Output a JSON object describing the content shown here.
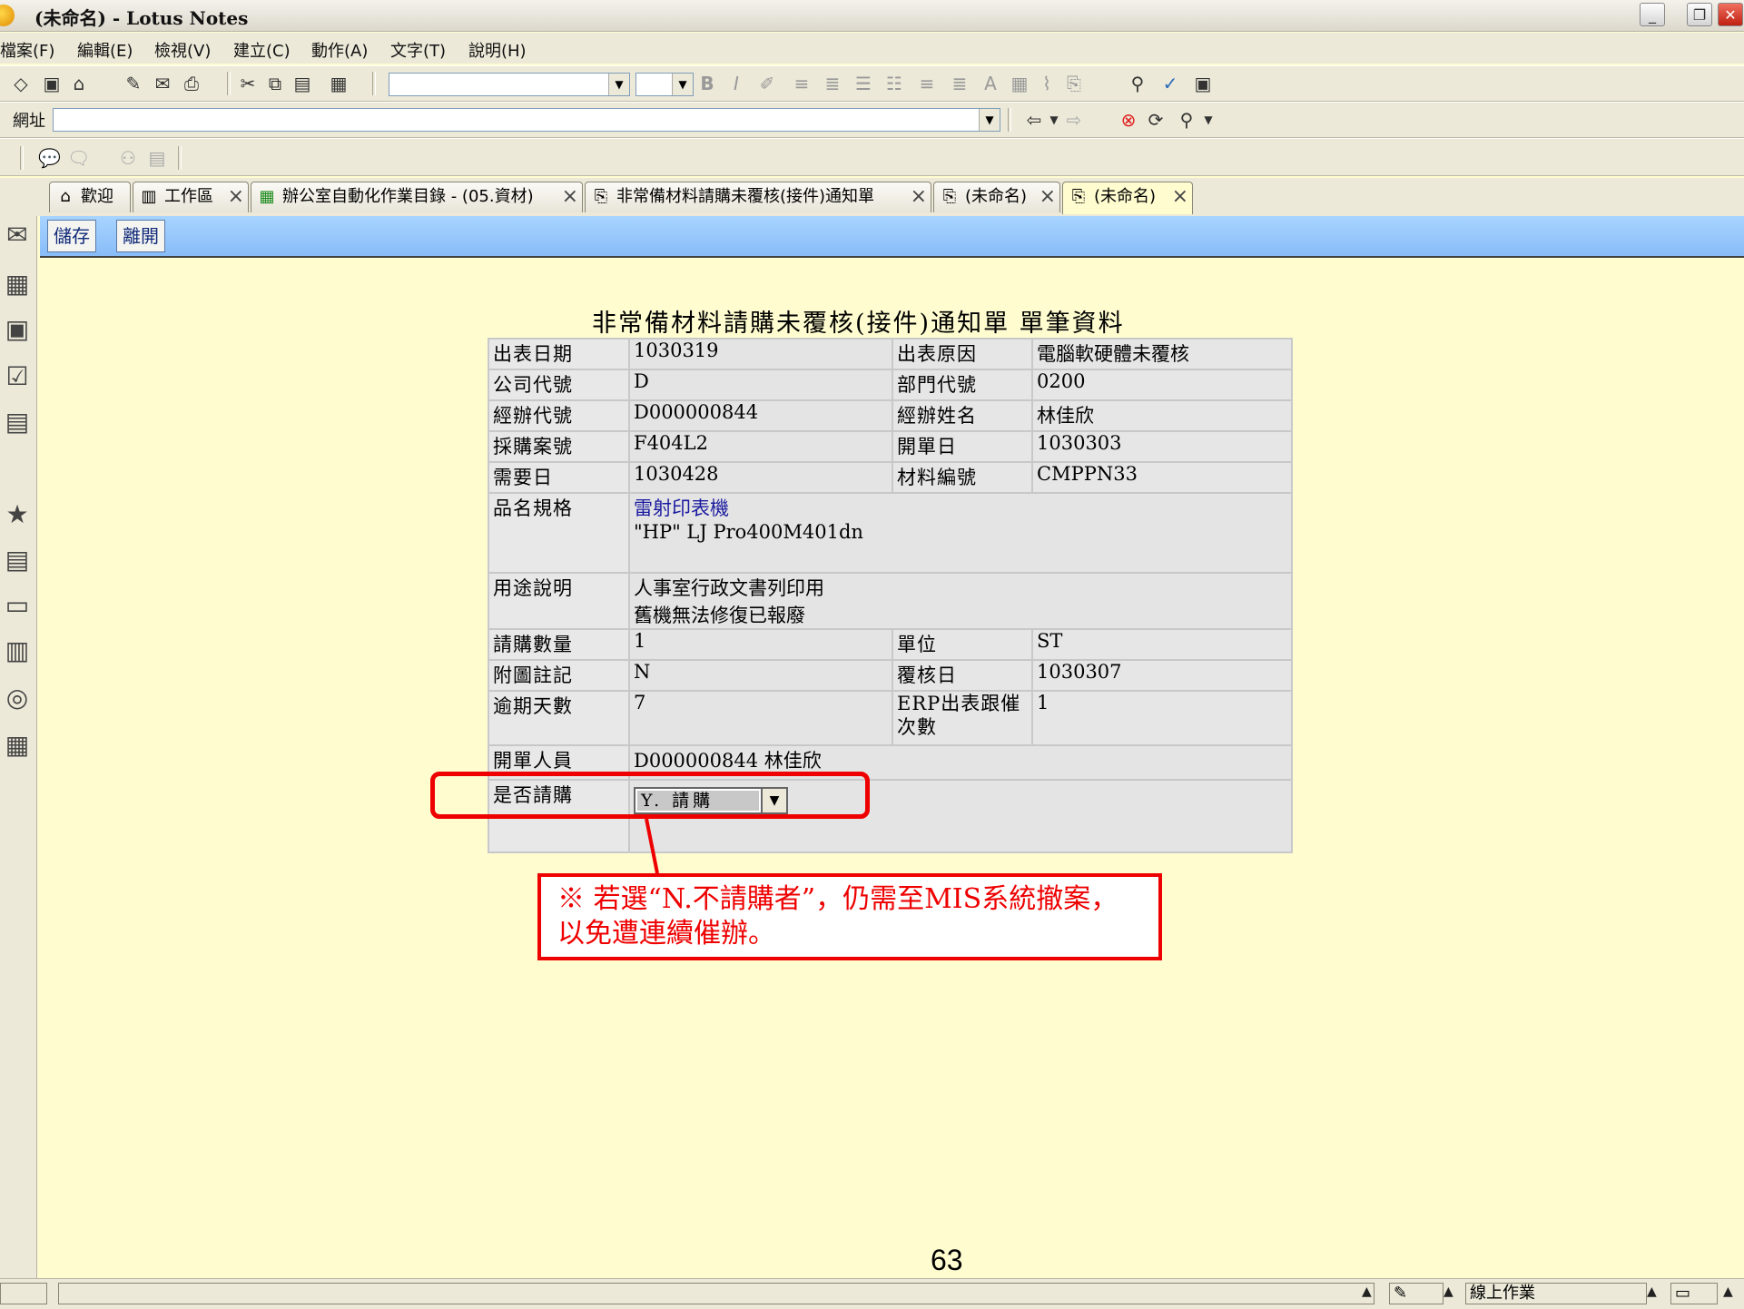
{
  "window": {
    "title": "(未命名) - Lotus Notes"
  },
  "menu": [
    "檔案(F)",
    "編輯(E)",
    "檢視(V)",
    "建立(C)",
    "動作(A)",
    "文字(T)",
    "說明(H)"
  ],
  "address": {
    "label": "網址"
  },
  "tabs": [
    {
      "label": "歡迎",
      "icon": "home-icon"
    },
    {
      "label": "工作區",
      "icon": "workspace-icon"
    },
    {
      "label": "辦公室自動化作業目錄 - (05.資材)",
      "icon": "database-icon"
    },
    {
      "label": "非常備材料請購未覆核(接件)通知單",
      "icon": "document-icon"
    },
    {
      "label": "(未命名)",
      "icon": "document-icon"
    },
    {
      "label": "(未命名)",
      "icon": "document-icon"
    }
  ],
  "actions": {
    "save": "儲存",
    "exit": "離開"
  },
  "form": {
    "title": "非常備材料請購未覆核(接件)通知單 單筆資料",
    "rows": {
      "print_date_label": "出表日期",
      "print_date": "1030319",
      "reason_label": "出表原因",
      "reason": "電腦軟硬體未覆核",
      "company_label": "公司代號",
      "company": "D",
      "dept_label": "部門代號",
      "dept": "0200",
      "handler_code_label": "經辦代號",
      "handler_code": "D000000844",
      "handler_name_label": "經辦姓名",
      "handler_name": "林佳欣",
      "purchase_no_label": "採購案號",
      "purchase_no": "F404L2",
      "open_date_label": "開單日",
      "open_date": "1030303",
      "need_date_label": "需要日",
      "need_date": "1030428",
      "material_no_label": "材料編號",
      "material_no": "CMPPN33",
      "spec_label": "品名規格",
      "spec_line1": "雷射印表機",
      "spec_line2": "\"HP\" LJ Pro400M401dn",
      "purpose_label": "用途說明",
      "purpose_line1": "人事室行政文書列印用",
      "purpose_line2": "舊機無法修復已報廢",
      "qty_label": "請購數量",
      "qty": "1",
      "unit_label": "單位",
      "unit": "ST",
      "attach_label": "附圖註記",
      "attach": "N",
      "review_date_label": "覆核日",
      "review_date": "1030307",
      "overdue_label": "逾期天數",
      "overdue": "7",
      "erp_label": "ERP出表跟催次數",
      "erp": "1",
      "opener_label": "開單人員",
      "opener": "D000000844 林佳欣",
      "purchase_q_label": "是否請購",
      "purchase_q": "Y. 請購"
    }
  },
  "callout": {
    "text": "※ 若選“N.不請購者”，仍需至MIS系統撤案，以免遭連續催辦。"
  },
  "page_number": "63",
  "status": {
    "mode": "線上作業"
  },
  "colors": {
    "background": "#fffdd0",
    "accent_red": "#ee0000",
    "action_bar": "#98c8fc"
  }
}
